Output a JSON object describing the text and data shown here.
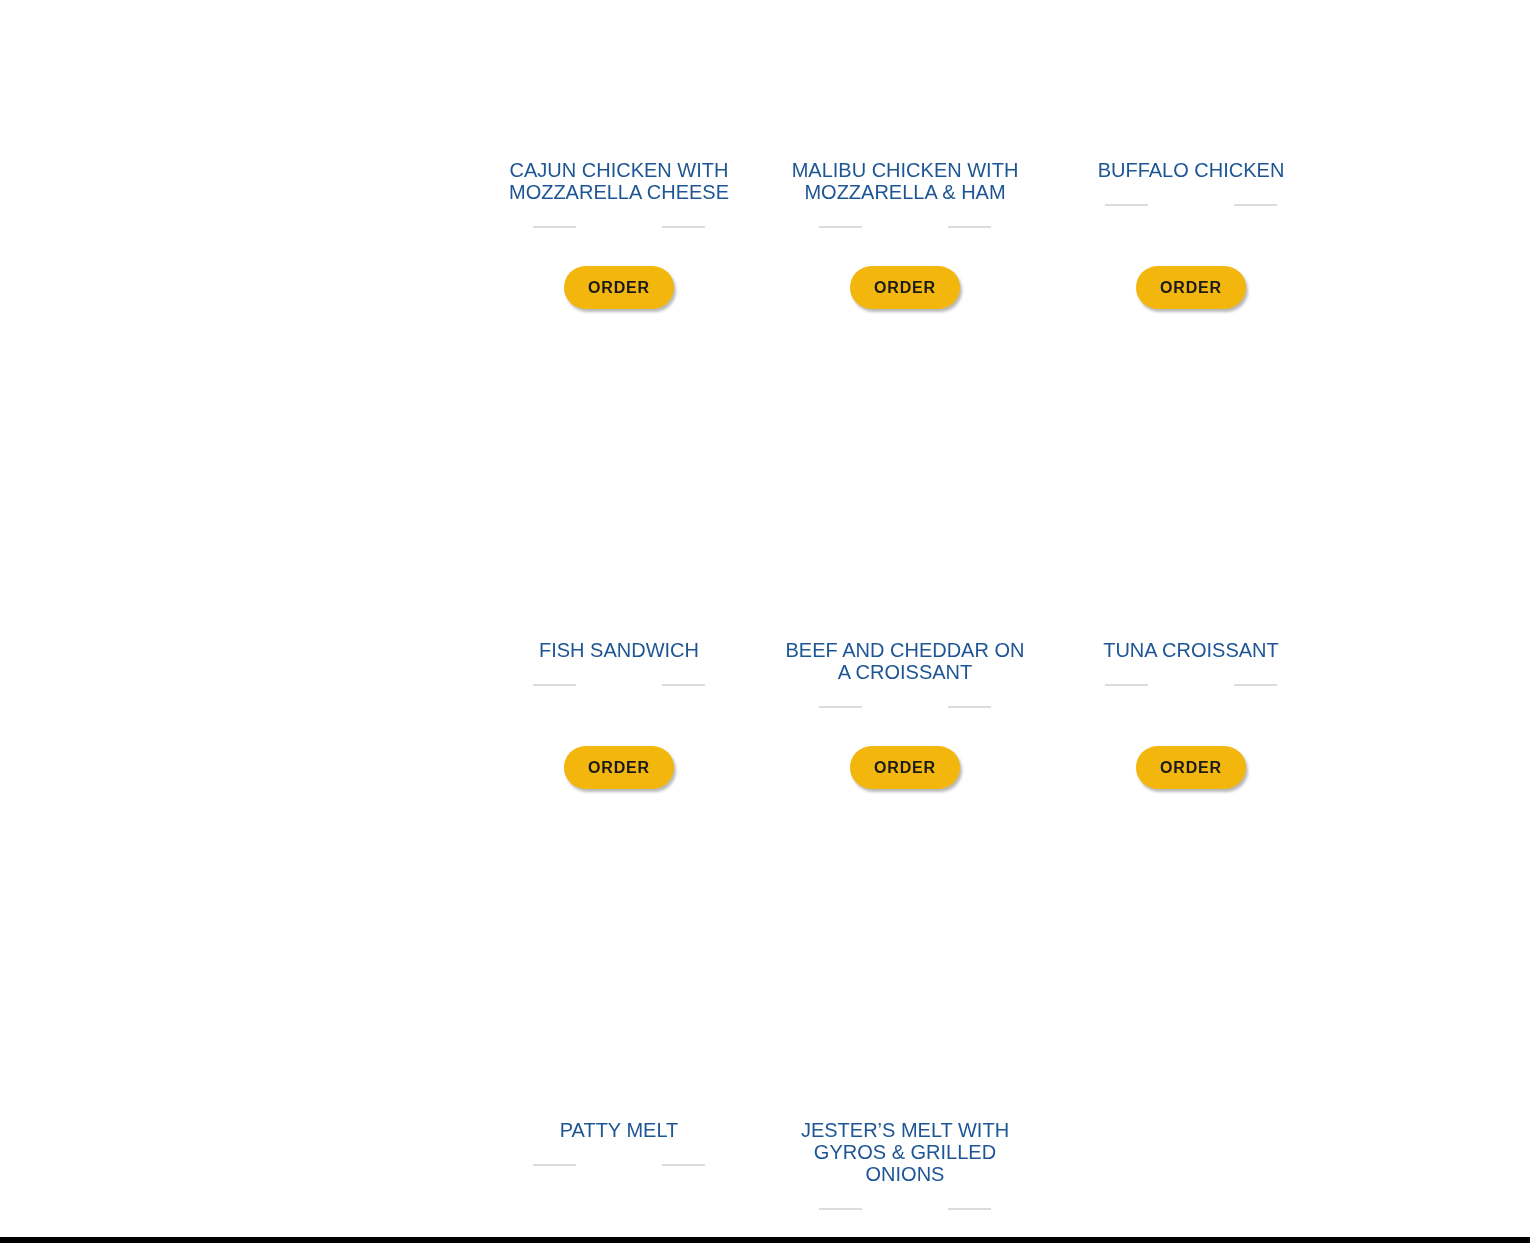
{
  "menu_items": [
    {
      "title": "CAJUN CHICKEN WITH MOZZARELLA CHEESE",
      "button": "ORDER"
    },
    {
      "title": "MALIBU CHICKEN WITH MOZZARELLA & HAM",
      "button": "ORDER"
    },
    {
      "title": "BUFFALO CHICKEN",
      "button": "ORDER"
    },
    {
      "title": "FISH SANDWICH",
      "button": "ORDER"
    },
    {
      "title": "BEEF AND CHEDDAR ON A CROISSANT",
      "button": "ORDER"
    },
    {
      "title": "TUNA CROISSANT",
      "button": "ORDER"
    },
    {
      "title": "PATTY MELT"
    },
    {
      "title": "JESTER’S MELT WITH GYROS & GRILLED ONIONS"
    }
  ]
}
